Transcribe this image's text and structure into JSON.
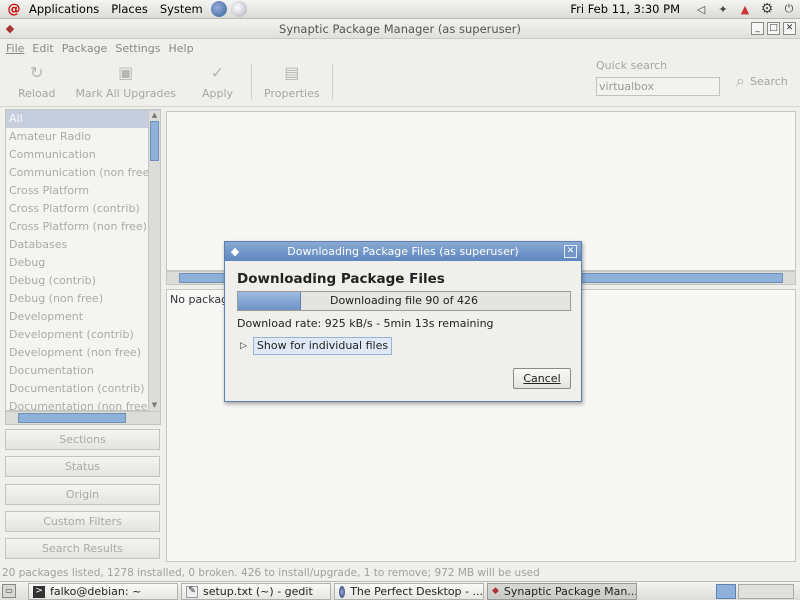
{
  "top_panel": {
    "menus": [
      "Applications",
      "Places",
      "System"
    ],
    "clock": "Fri Feb 11,  3:30 PM"
  },
  "window": {
    "title": "Synaptic Package Manager  (as superuser)",
    "menubar": [
      "File",
      "Edit",
      "Package",
      "Settings",
      "Help"
    ]
  },
  "toolbar": {
    "reload": "Reload",
    "mark_all": "Mark All Upgrades",
    "apply": "Apply",
    "properties": "Properties",
    "quick_search_label": "Quick search",
    "quick_search_value": "virtualbox",
    "search": "Search"
  },
  "sections": [
    "All",
    "Amateur Radio",
    "Communication",
    "Communication (non free)",
    "Cross Platform",
    "Cross Platform (contrib)",
    "Cross Platform (non free)",
    "Databases",
    "Debug",
    "Debug (contrib)",
    "Debug (non free)",
    "Development",
    "Development (contrib)",
    "Development (non free)",
    "Documentation",
    "Documentation (contrib)",
    "Documentation (non free)"
  ],
  "side_buttons": {
    "sections": "Sections",
    "status": "Status",
    "origin": "Origin",
    "custom_filters": "Custom Filters",
    "search_results": "Search Results"
  },
  "desc_pane": {
    "text": "No package"
  },
  "statusbar": "20 packages listed, 1278 installed, 0 broken. 426 to install/upgrade, 1 to remove; 972 MB will be used",
  "dialog": {
    "title": "Downloading Package Files (as superuser)",
    "heading": "Downloading Package Files",
    "progress_text": "Downloading file 90 of 426",
    "progress_fraction": 0.19,
    "rate": "Download rate: 925 kB/s - 5min 13s remaining",
    "expander": "Show for individual files",
    "cancel": "Cancel"
  },
  "taskbar": [
    "falko@debian: ~",
    "setup.txt (~) - gedit",
    "The Perfect Desktop - ...",
    "Synaptic Package Man..."
  ],
  "colors": {
    "selection": "#c6cedd",
    "progress": "#6c93c8",
    "dialog_title": "#5e86bf"
  }
}
